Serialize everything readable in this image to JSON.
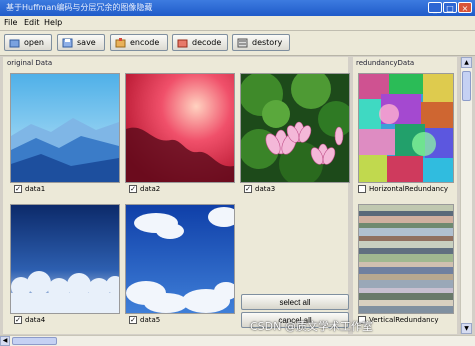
{
  "window": {
    "title": "基于Huffman编码与分层冗余的图像隐藏"
  },
  "menu": {
    "file": "File",
    "edit": "Edit",
    "help": "Help"
  },
  "toolbar": {
    "open": "open",
    "save": "save",
    "encode": "encode",
    "decode": "decode",
    "destroy": "destory"
  },
  "original_panel": {
    "label": "original Data",
    "items": [
      {
        "label": "data1",
        "checked": true
      },
      {
        "label": "data2",
        "checked": true
      },
      {
        "label": "data3",
        "checked": true
      },
      {
        "label": "data4",
        "checked": true
      },
      {
        "label": "data5",
        "checked": true
      }
    ],
    "select_all": "select all",
    "cancel_all": "cancel all"
  },
  "redundancy_panel": {
    "label": "redundancyData",
    "items": [
      {
        "label": "HorizontalRedundancy",
        "checked": false
      },
      {
        "label": "VerticalRedundancy",
        "checked": false
      }
    ]
  },
  "watermark": "CSDN @质文学术工作室",
  "colors": {
    "titlebar": "#1f5bc9",
    "panel": "#ece9d8"
  }
}
